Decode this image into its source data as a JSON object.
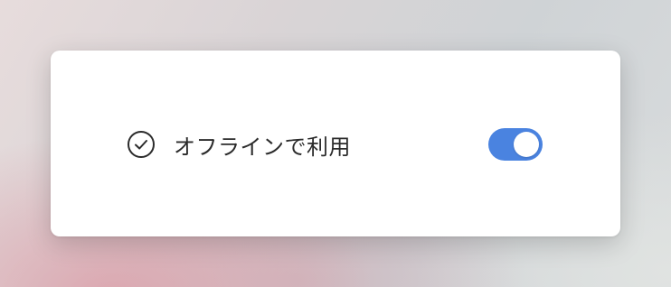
{
  "setting": {
    "label": "オフラインで利用",
    "icon": "check-circle-icon",
    "enabled": true
  },
  "colors": {
    "toggle_on": "#4a83e0",
    "text": "#2b2b2b",
    "card": "#ffffff"
  }
}
